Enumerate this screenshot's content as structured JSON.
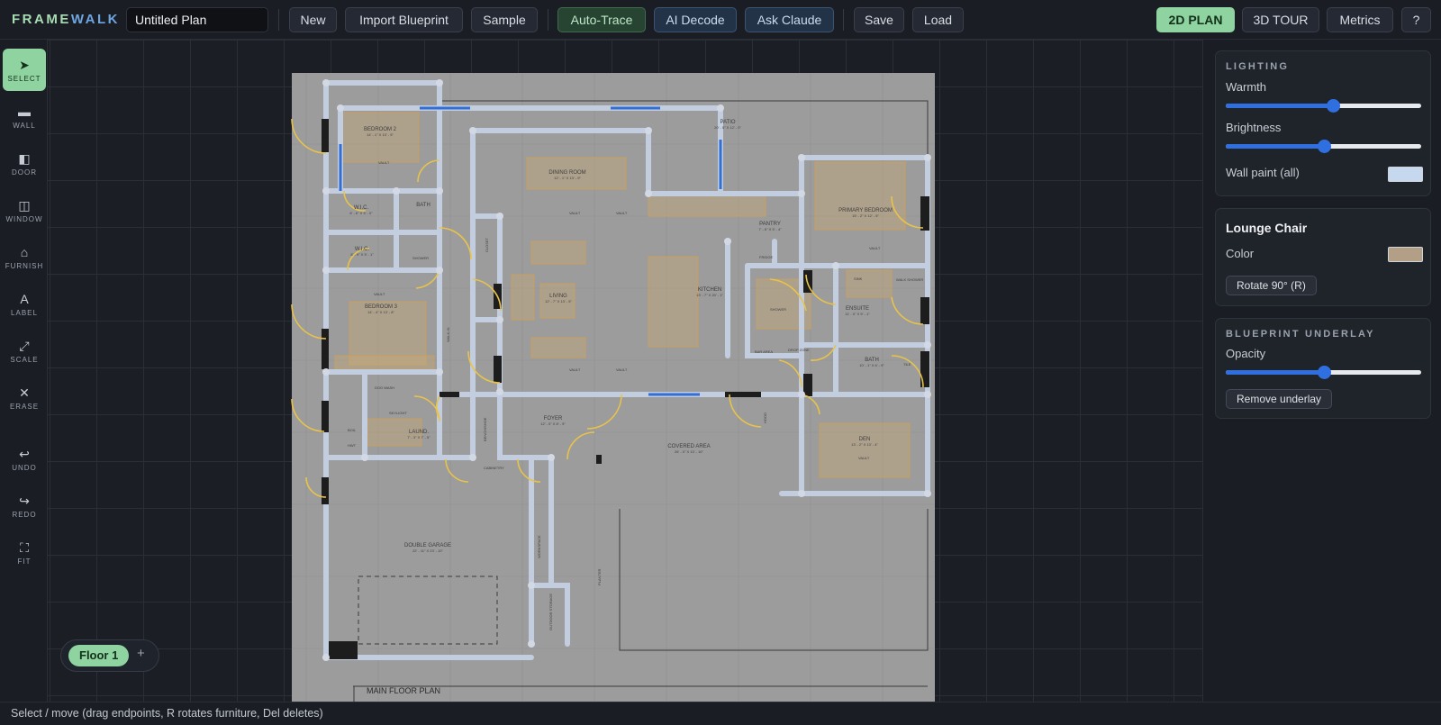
{
  "app": {
    "logo_a": "FRAME",
    "logo_b": "WALK"
  },
  "toolbar": {
    "title_value": "Untitled Plan",
    "new": "New",
    "import": "Import Blueprint",
    "sample": "Sample",
    "autotrace": "Auto-Trace",
    "aidecode": "AI Decode",
    "askclaude": "Ask Claude",
    "save": "Save",
    "load": "Load",
    "plan2d": "2D PLAN",
    "tour3d": "3D TOUR",
    "metrics": "Metrics",
    "help": "?"
  },
  "tools": {
    "select": "SELECT",
    "wall": "WALL",
    "door": "DOOR",
    "window": "WINDOW",
    "furnish": "FURNISH",
    "label": "LABEL",
    "scale": "SCALE",
    "erase": "ERASE",
    "undo": "UNDO",
    "redo": "REDO",
    "fit": "FIT"
  },
  "blueprint": {
    "rooms": [
      {
        "name": "BEDROOM 2",
        "dims": "14' - 1\" X 13' - 5\""
      },
      {
        "name": "DINING ROOM",
        "dims": "12' - 1\" X 13' - 9\""
      },
      {
        "name": "PATIO",
        "dims": "20' - 5\" X 12' - 0\""
      },
      {
        "name": "BATH",
        "dims": ""
      },
      {
        "name": "W.I.C.",
        "dims": "8' - 6\" X 5' - 0\""
      },
      {
        "name": "PRIMARY BEDROOM",
        "dims": "15' - 2\" X 12' - 5\""
      },
      {
        "name": "PANTRY",
        "dims": "7' - 6\" X 5' - 4\""
      },
      {
        "name": "W.I.C.",
        "dims": "8' - 9\" X 5' - 1\""
      },
      {
        "name": "LIVING",
        "dims": "12' - 7\" X 13' - 5\""
      },
      {
        "name": "KITCHEN",
        "dims": "13' - 7\" X 20' - 1\""
      },
      {
        "name": "BEDROOM 3",
        "dims": "14' - 4\" X 13' - 8\""
      },
      {
        "name": "ENSUITE",
        "dims": "11' - 0\" X 9' - 1\""
      },
      {
        "name": "BATH",
        "dims": "10' - 1\" X 6' - 9\""
      },
      {
        "name": "FOYER",
        "dims": "12' - 0\" X 8' - 9\""
      },
      {
        "name": "LAUND.",
        "dims": "7' - 3\" X 7' - 5\""
      },
      {
        "name": "COVERED AREA",
        "dims": "26' - 0\" X 13' - 10\""
      },
      {
        "name": "DEN",
        "dims": "13' - 2\" X 13' - 4\""
      },
      {
        "name": "DOUBLE GARAGE",
        "dims": "22' - 11\" X 23' - 10\""
      }
    ],
    "notes": {
      "vault": "VAULT",
      "closet": "CLOSET",
      "doghouse": "DOG WASH",
      "skylight": "SKYLIGHT",
      "shower": "SHOWER",
      "pantry_fridge": "FRIDGE",
      "bar": "BAR AREA",
      "drop": "DROP ZONE",
      "bench": "BENCH/SHOE",
      "walkin_sm": "WALK-IN",
      "carpentry": "CABINETRY",
      "workspace": "WORKSPACE",
      "planter": "PLANTER",
      "outdoor_storage": "OUTDOOR STORAGE",
      "hwt": "HWT",
      "boil": "BOIL",
      "tile": "TILE",
      "walk_shower": "WALK SHOWER",
      "sink": "SINK",
      "ensuite_shower": "SHOWER",
      "hood": "HOOD"
    },
    "plan_title": "MAIN FLOOR PLAN"
  },
  "floors": {
    "current": "Floor 1",
    "add": "+"
  },
  "panel": {
    "lighting": {
      "title": "LIGHTING",
      "warmth_label": "Warmth",
      "warmth": 0.55,
      "brightness_label": "Brightness",
      "brightness": 0.5,
      "wallpaint_label": "Wall paint (all)",
      "wallpaint_color": "#c5d8ee"
    },
    "selection": {
      "title": "Lounge Chair",
      "color_label": "Color",
      "color": "#b39e86",
      "rotate": "Rotate 90° (R)"
    },
    "underlay": {
      "title": "BLUEPRINT UNDERLAY",
      "opacity_label": "Opacity",
      "opacity": 0.5,
      "remove": "Remove underlay"
    }
  },
  "status": "Select / move (drag endpoints, R rotates furniture, Del deletes)"
}
